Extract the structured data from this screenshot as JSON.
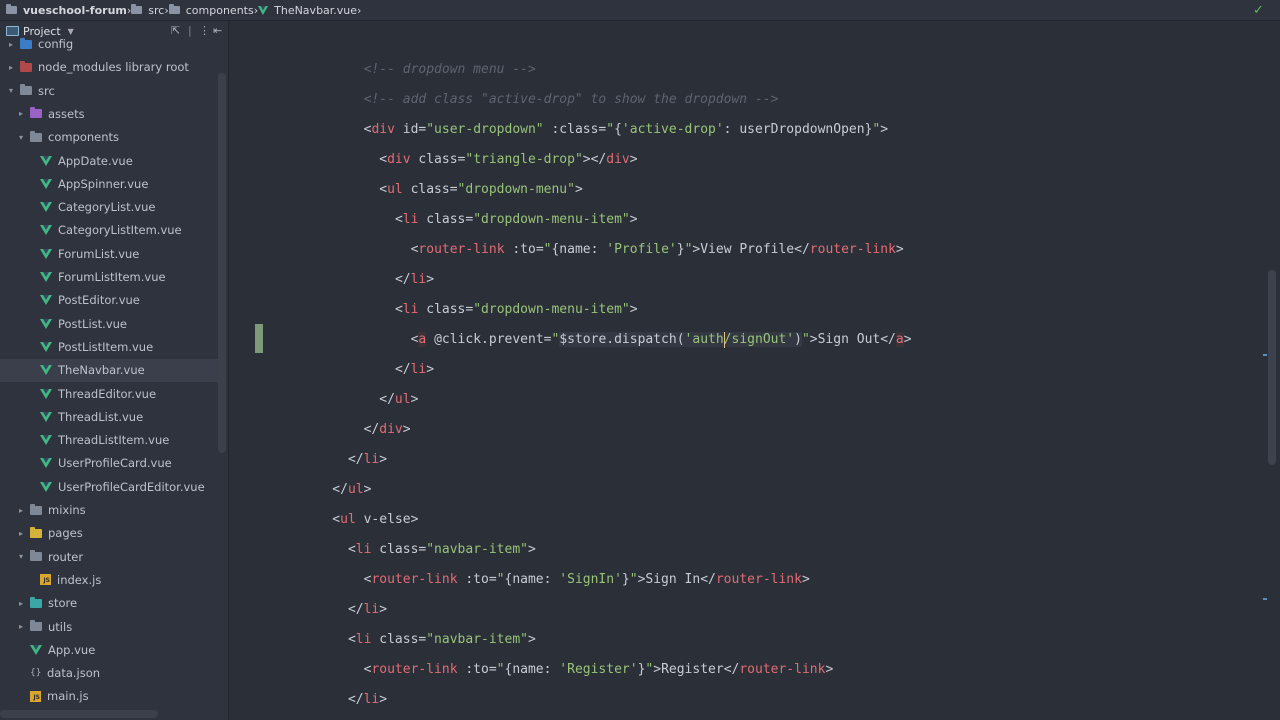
{
  "breadcrumb": {
    "project": "vueschool-forum",
    "src": "src",
    "components": "components",
    "file": "TheNavbar.vue"
  },
  "sidebar": {
    "header": {
      "title": "Project"
    },
    "rows": [
      {
        "label": "config",
        "icon": "folder-icon",
        "color": "#3b7dc4",
        "arrow": "▸",
        "indent": 0
      },
      {
        "label": "node_modules  library root",
        "icon": "folder-icon",
        "color": "#b04a4a",
        "arrow": "▸",
        "indent": 0
      },
      {
        "label": "src",
        "icon": "folder-icon",
        "color": "#7f8897",
        "arrow": "▾",
        "indent": 0
      },
      {
        "label": "assets",
        "icon": "folder-icon",
        "color": "#9a62c6",
        "arrow": "▸",
        "indent": 1
      },
      {
        "label": "components",
        "icon": "folder-icon",
        "color": "#7f8897",
        "arrow": "▾",
        "indent": 1
      },
      {
        "label": "AppDate.vue",
        "icon": "vue-icon",
        "indent": 2
      },
      {
        "label": "AppSpinner.vue",
        "icon": "vue-icon",
        "indent": 2
      },
      {
        "label": "CategoryList.vue",
        "icon": "vue-icon",
        "indent": 2
      },
      {
        "label": "CategoryListItem.vue",
        "icon": "vue-icon",
        "indent": 2
      },
      {
        "label": "ForumList.vue",
        "icon": "vue-icon",
        "indent": 2
      },
      {
        "label": "ForumListItem.vue",
        "icon": "vue-icon",
        "indent": 2
      },
      {
        "label": "PostEditor.vue",
        "icon": "vue-icon",
        "indent": 2
      },
      {
        "label": "PostList.vue",
        "icon": "vue-icon",
        "indent": 2
      },
      {
        "label": "PostListItem.vue",
        "icon": "vue-icon",
        "indent": 2
      },
      {
        "label": "TheNavbar.vue",
        "icon": "vue-icon",
        "indent": 2,
        "selected": true
      },
      {
        "label": "ThreadEditor.vue",
        "icon": "vue-icon",
        "indent": 2
      },
      {
        "label": "ThreadList.vue",
        "icon": "vue-icon",
        "indent": 2
      },
      {
        "label": "ThreadListItem.vue",
        "icon": "vue-icon",
        "indent": 2
      },
      {
        "label": "UserProfileCard.vue",
        "icon": "vue-icon",
        "indent": 2
      },
      {
        "label": "UserProfileCardEditor.vue",
        "icon": "vue-icon",
        "indent": 2
      },
      {
        "label": "mixins",
        "icon": "folder-icon",
        "color": "#7f8897",
        "arrow": "▸",
        "indent": 1
      },
      {
        "label": "pages",
        "icon": "folder-icon",
        "color": "#d4b23a",
        "arrow": "▸",
        "indent": 1
      },
      {
        "label": "router",
        "icon": "folder-icon",
        "color": "#7f8897",
        "arrow": "▾",
        "indent": 1
      },
      {
        "label": "index.js",
        "icon": "js-icon",
        "indent": 2
      },
      {
        "label": "store",
        "icon": "folder-icon",
        "color": "#3aa6a6",
        "arrow": "▸",
        "indent": 1
      },
      {
        "label": "utils",
        "icon": "folder-icon",
        "color": "#7f8897",
        "arrow": "▸",
        "indent": 1
      },
      {
        "label": "App.vue",
        "icon": "vue-icon",
        "indent": 1
      },
      {
        "label": "data.json",
        "icon": "json-icon",
        "indent": 1
      },
      {
        "label": "main.js",
        "icon": "js-icon",
        "indent": 1
      }
    ]
  },
  "editor": {
    "lines": [
      {
        "indent": 7,
        "tokens": [
          [
            "cm",
            "<!-- dropdown menu -->"
          ]
        ]
      },
      {
        "indent": 7,
        "tokens": [
          [
            "cm",
            "<!-- add class \"active-drop\" to show the dropdown -->"
          ]
        ]
      },
      {
        "indent": 7,
        "tokens": [
          [
            "pl",
            "<"
          ],
          [
            "tg",
            "div"
          ],
          [
            "at",
            " id="
          ],
          [
            "av",
            "\"user-dropdown\""
          ],
          [
            "at",
            " :class="
          ],
          [
            "av",
            "\""
          ],
          [
            "pl",
            "{"
          ],
          [
            "av",
            "'active-drop'"
          ],
          [
            "pl",
            ": userDropdownOpen}"
          ],
          [
            "av",
            "\""
          ],
          [
            "pl",
            ">"
          ]
        ]
      },
      {
        "indent": 8,
        "tokens": [
          [
            "pl",
            "<"
          ],
          [
            "tg",
            "div"
          ],
          [
            "at",
            " class="
          ],
          [
            "av",
            "\"triangle-drop\""
          ],
          [
            "pl",
            "></"
          ],
          [
            "tg",
            "div"
          ],
          [
            "pl",
            ">"
          ]
        ]
      },
      {
        "indent": 8,
        "tokens": [
          [
            "pl",
            "<"
          ],
          [
            "tg",
            "ul"
          ],
          [
            "at",
            " class="
          ],
          [
            "av",
            "\"dropdown-menu\""
          ],
          [
            "pl",
            ">"
          ]
        ]
      },
      {
        "indent": 9,
        "tokens": [
          [
            "pl",
            "<"
          ],
          [
            "tg",
            "li"
          ],
          [
            "at",
            " class="
          ],
          [
            "av",
            "\"dropdown-menu-item\""
          ],
          [
            "pl",
            ">"
          ]
        ]
      },
      {
        "indent": 10,
        "tokens": [
          [
            "pl",
            "<"
          ],
          [
            "tg",
            "router-link"
          ],
          [
            "at",
            " :to="
          ],
          [
            "av",
            "\""
          ],
          [
            "pl",
            "{name: "
          ],
          [
            "av",
            "'Profile'"
          ],
          [
            "pl",
            "}"
          ],
          [
            "av",
            "\""
          ],
          [
            "pl",
            ">"
          ],
          [
            "tx",
            "View Profile"
          ],
          [
            "pl",
            "</"
          ],
          [
            "tg",
            "router-link"
          ],
          [
            "pl",
            ">"
          ]
        ]
      },
      {
        "indent": 9,
        "tokens": [
          [
            "pl",
            "</"
          ],
          [
            "tg",
            "li"
          ],
          [
            "pl",
            ">"
          ]
        ]
      },
      {
        "indent": 9,
        "tokens": [
          [
            "pl",
            "<"
          ],
          [
            "tg",
            "li"
          ],
          [
            "at",
            " class="
          ],
          [
            "av",
            "\"dropdown-menu-item\""
          ],
          [
            "pl",
            ">"
          ]
        ]
      },
      {
        "indent": 10,
        "tokens": [
          [
            "pl",
            "<"
          ],
          [
            "tg hl",
            "a"
          ],
          [
            "at",
            " @click.prevent="
          ],
          [
            "av",
            "\""
          ],
          [
            "pl expr-bg",
            "$store.dispatch("
          ],
          [
            "av expr-bg",
            "'auth/signOut'"
          ],
          [
            "pl expr-bg",
            ")"
          ],
          [
            "av",
            "\""
          ],
          [
            "pl",
            ">"
          ],
          [
            "tx",
            "Sign Out"
          ],
          [
            "pl",
            "</"
          ],
          [
            "tg hl",
            "a"
          ],
          [
            "pl",
            ">"
          ]
        ]
      },
      {
        "indent": 9,
        "tokens": [
          [
            "pl",
            "</"
          ],
          [
            "tg",
            "li"
          ],
          [
            "pl",
            ">"
          ]
        ]
      },
      {
        "indent": 8,
        "tokens": [
          [
            "pl",
            "</"
          ],
          [
            "tg",
            "ul"
          ],
          [
            "pl",
            ">"
          ]
        ]
      },
      {
        "indent": 7,
        "tokens": [
          [
            "pl",
            "</"
          ],
          [
            "tg",
            "div"
          ],
          [
            "pl",
            ">"
          ]
        ]
      },
      {
        "indent": 6,
        "tokens": [
          [
            "pl",
            "</"
          ],
          [
            "tg",
            "li"
          ],
          [
            "pl",
            ">"
          ]
        ]
      },
      {
        "indent": 5,
        "tokens": [
          [
            "pl",
            "</"
          ],
          [
            "tg",
            "ul"
          ],
          [
            "pl",
            ">"
          ]
        ]
      },
      {
        "indent": 5,
        "tokens": [
          [
            "pl",
            "<"
          ],
          [
            "tg",
            "ul"
          ],
          [
            "at",
            " v-else"
          ],
          [
            "pl",
            ">"
          ]
        ]
      },
      {
        "indent": 6,
        "tokens": [
          [
            "pl",
            "<"
          ],
          [
            "tg",
            "li"
          ],
          [
            "at",
            " class="
          ],
          [
            "av",
            "\"navbar-item\""
          ],
          [
            "pl",
            ">"
          ]
        ]
      },
      {
        "indent": 7,
        "tokens": [
          [
            "pl",
            "<"
          ],
          [
            "tg",
            "router-link"
          ],
          [
            "at",
            " :to="
          ],
          [
            "av",
            "\""
          ],
          [
            "pl",
            "{name: "
          ],
          [
            "av",
            "'SignIn'"
          ],
          [
            "pl",
            "}"
          ],
          [
            "av",
            "\""
          ],
          [
            "pl",
            ">"
          ],
          [
            "tx",
            "Sign In"
          ],
          [
            "pl",
            "</"
          ],
          [
            "tg",
            "router-link"
          ],
          [
            "pl",
            ">"
          ]
        ]
      },
      {
        "indent": 6,
        "tokens": [
          [
            "pl",
            "</"
          ],
          [
            "tg",
            "li"
          ],
          [
            "pl",
            ">"
          ]
        ]
      },
      {
        "indent": 6,
        "tokens": [
          [
            "pl",
            "<"
          ],
          [
            "tg",
            "li"
          ],
          [
            "at",
            " class="
          ],
          [
            "av",
            "\"navbar-item\""
          ],
          [
            "pl",
            ">"
          ]
        ]
      },
      {
        "indent": 7,
        "tokens": [
          [
            "pl",
            "<"
          ],
          [
            "tg",
            "router-link"
          ],
          [
            "at",
            " :to="
          ],
          [
            "av",
            "\""
          ],
          [
            "pl",
            "{name: "
          ],
          [
            "av",
            "'Register'"
          ],
          [
            "pl",
            "}"
          ],
          [
            "av",
            "\""
          ],
          [
            "pl",
            ">"
          ],
          [
            "tx",
            "Register"
          ],
          [
            "pl",
            "</"
          ],
          [
            "tg",
            "router-link"
          ],
          [
            "pl",
            ">"
          ]
        ]
      },
      {
        "indent": 6,
        "tokens": [
          [
            "pl",
            "</"
          ],
          [
            "tg",
            "li"
          ],
          [
            "pl",
            ">"
          ]
        ]
      }
    ]
  }
}
